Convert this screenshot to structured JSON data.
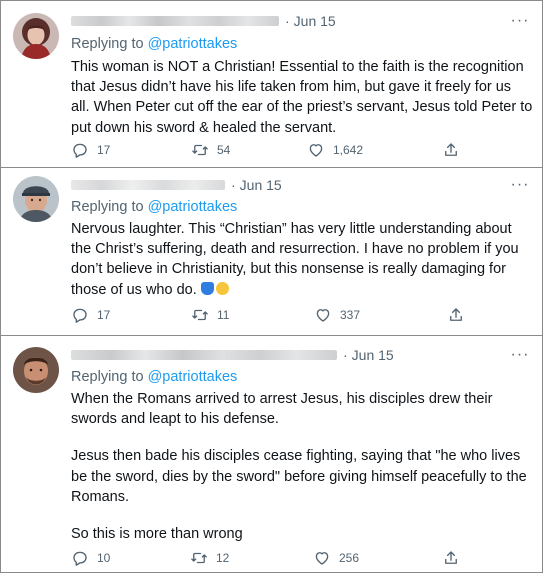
{
  "tweets": [
    {
      "time": "Jun 15",
      "reply_prefix": "Replying to",
      "reply_handle": "@patriottakes",
      "text": [
        "This woman is NOT a Christian! Essential to the faith is the recognition that Jesus didn’t have his life taken from him, but gave it freely for us all. When Peter cut off the ear of the priest’s servant, Jesus told Peter to put down his sword & healed the servant."
      ],
      "replies": "17",
      "retweets": "54",
      "likes": "1,642"
    },
    {
      "time": "Jun 15",
      "reply_prefix": "Replying to",
      "reply_handle": "@patriottakes",
      "text": [
        "Nervous laughter. This “Christian” has very little understanding about the Christ’s suffering, death and resurrection. I have no problem if you don’t believe in Christianity, but this nonsense is really damaging for those of us who do."
      ],
      "emoji": [
        "person-facepalming-emoji",
        "crying-face-emoji"
      ],
      "replies": "17",
      "retweets": "11",
      "likes": "337"
    },
    {
      "time": "Jun 15",
      "reply_prefix": "Replying to",
      "reply_handle": "@patriottakes",
      "text": [
        "When the Romans arrived to arrest Jesus, his disciples drew their swords and leapt to his defense.",
        "Jesus then bade his disciples cease fighting, saying that \"he who lives be the sword, dies by the sword\" before giving himself peacefully to the Romans.",
        "So this is more than wrong"
      ],
      "replies": "10",
      "retweets": "12",
      "likes": "256"
    }
  ],
  "icons": {
    "more": "more-dots-icon",
    "reply": "reply-icon",
    "retweet": "retweet-icon",
    "like": "heart-icon",
    "share": "share-icon"
  },
  "colors": {
    "link": "#1d9bf0",
    "secondary": "#536471",
    "text": "#0f1419"
  }
}
